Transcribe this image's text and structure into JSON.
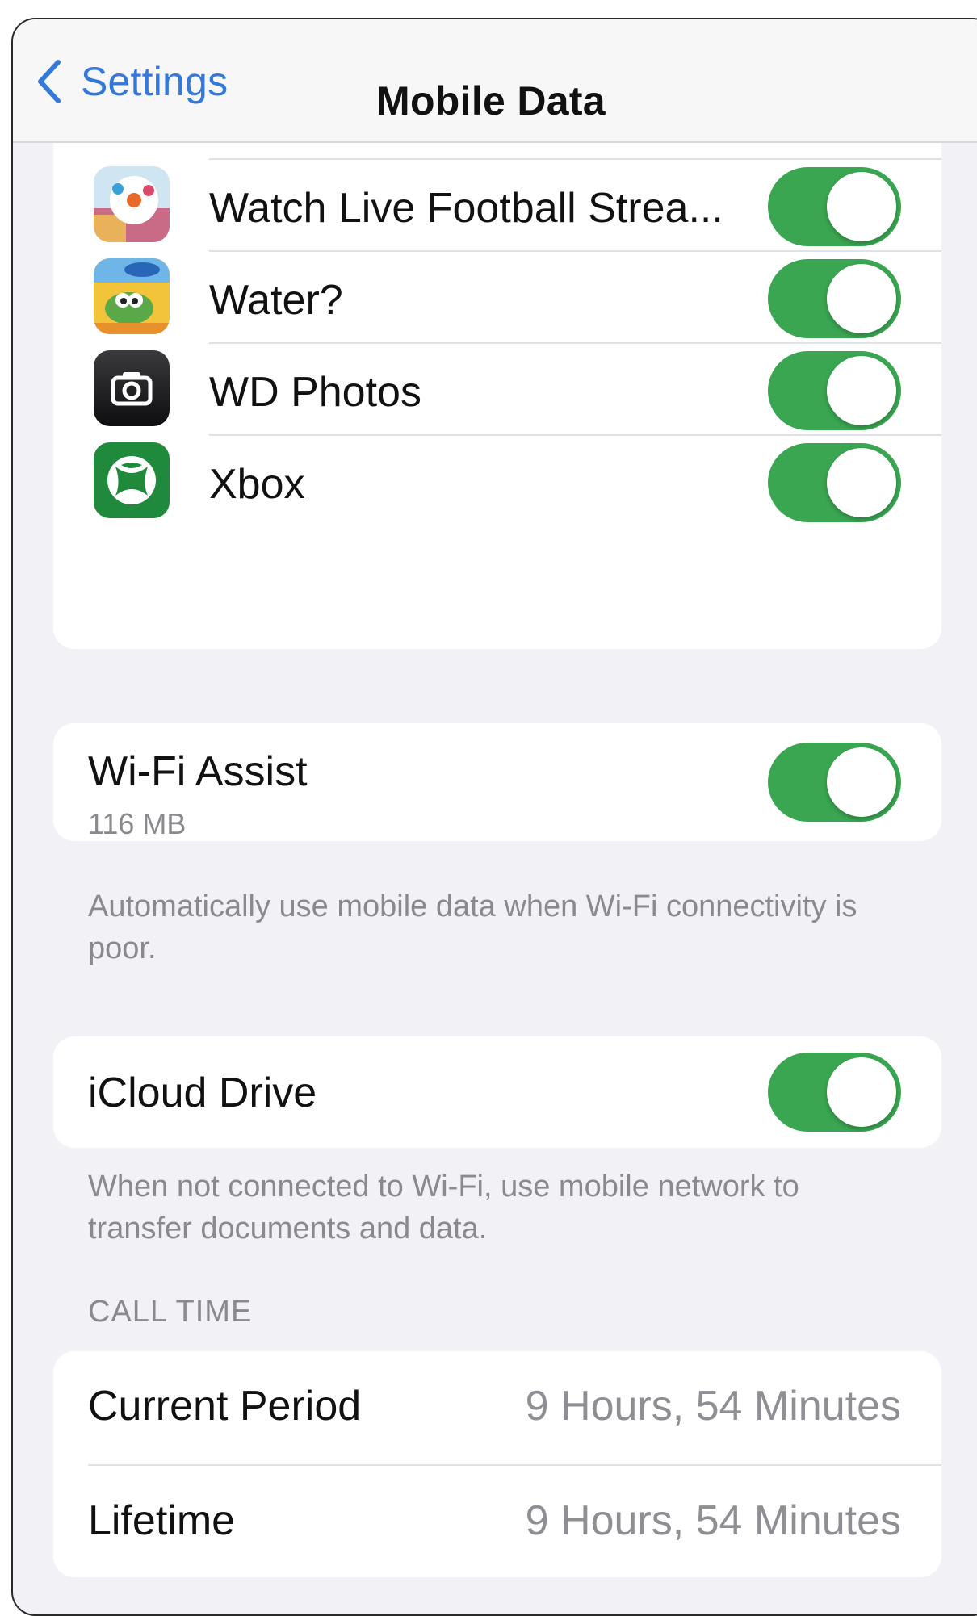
{
  "nav": {
    "back_label": "Settings",
    "title": "Mobile Data"
  },
  "apps": [
    {
      "name": "Watch Live Football Strea...",
      "icon": "football-app-icon",
      "enabled": true
    },
    {
      "name": "Water?",
      "icon": "wheres-my-water-app-icon",
      "enabled": true
    },
    {
      "name": "WD Photos",
      "icon": "camera-app-icon",
      "enabled": true
    },
    {
      "name": "Xbox",
      "icon": "xbox-app-icon",
      "enabled": true
    }
  ],
  "wifi_assist": {
    "label": "Wi-Fi Assist",
    "usage": "116 MB",
    "enabled": true,
    "footnote": "Automatically use mobile data when Wi-Fi connectivity is poor."
  },
  "icloud_drive": {
    "label": "iCloud Drive",
    "enabled": true,
    "footnote": "When not connected to Wi-Fi, use mobile network to transfer documents and data."
  },
  "call_time": {
    "header": "CALL TIME",
    "rows": [
      {
        "label": "Current Period",
        "value": "9 Hours, 54 Minutes"
      },
      {
        "label": "Lifetime",
        "value": "9 Hours, 54 Minutes"
      }
    ]
  },
  "colors": {
    "toggle_on": "#3aa652",
    "link_blue": "#3478d8",
    "background": "#f2f2f6"
  }
}
